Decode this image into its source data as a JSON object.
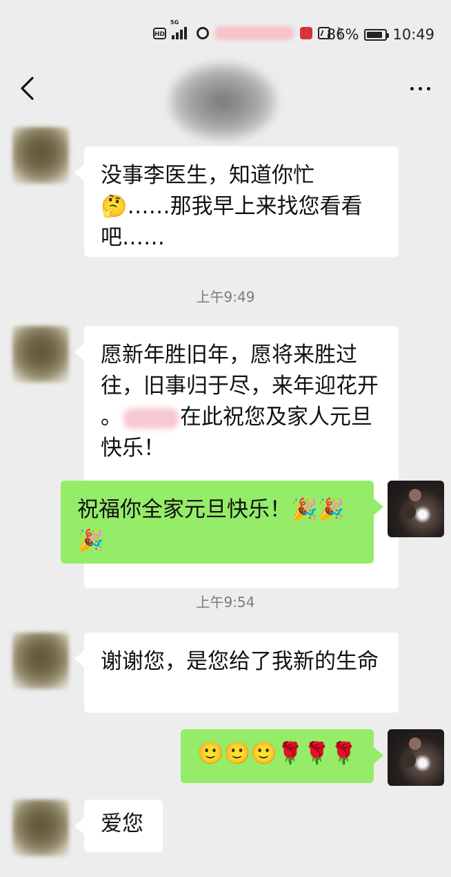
{
  "status_bar": {
    "hd_label": "HD",
    "signal_label": "5G",
    "battery_text": "86%",
    "time": "10:49",
    "battery_level": 0.86
  },
  "header": {
    "back_icon": "chevron-left-icon",
    "more_icon": "more-horizontal-icon"
  },
  "messages": [
    {
      "side": "left",
      "text": "没事李医生，知道你忙🤔……那我早上来找您看看吧……"
    },
    {
      "side": "left",
      "text_before": "愿新年胜旧年，愿将来胜过往，旧事归于尽，来年迎花开 。",
      "text_after": "在此祝您及家人元旦快乐！"
    },
    {
      "side": "right",
      "text": "祝福你全家元旦快乐！🎉🎉🎉"
    },
    {
      "side": "left",
      "text": "谢谢您，是您给了我新的生命"
    },
    {
      "side": "right",
      "text": "🙂🙂🙂🌹🌹🌹"
    },
    {
      "side": "left",
      "text": "爱您"
    }
  ],
  "timestamps": [
    "上午9:49",
    "上午9:54"
  ],
  "colors": {
    "background": "#ededed",
    "incoming_bubble": "#ffffff",
    "outgoing_bubble": "#95ec69",
    "timestamp": "#7a7a7a"
  }
}
